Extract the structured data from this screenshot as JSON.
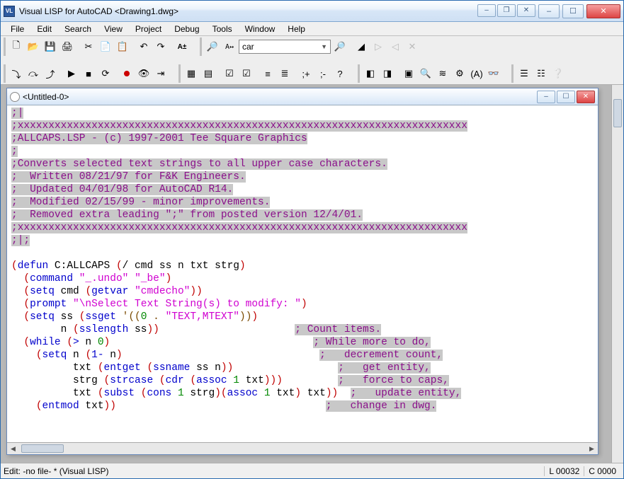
{
  "window": {
    "title": "Visual LISP for AutoCAD <Drawing1.dwg>"
  },
  "menu": {
    "file": "File",
    "edit": "Edit",
    "search": "Search",
    "view": "View",
    "project": "Project",
    "debug": "Debug",
    "tools": "Tools",
    "window": "Window",
    "help": "Help"
  },
  "toolbar": {
    "search_value": "car"
  },
  "child_window": {
    "title": "<Untitled-0>"
  },
  "code": {
    "l1": ";|",
    "l2": ";xxxxxxxxxxxxxxxxxxxxxxxxxxxxxxxxxxxxxxxxxxxxxxxxxxxxxxxxxxxxxxxxxxxxxxxxx",
    "l3": ";ALLCAPS.LSP - (c) 1997-2001 Tee Square Graphics",
    "l4": ";",
    "l5": ";Converts selected text strings to all upper case characters.",
    "l6": ";  Written 08/21/97 for F&K Engineers.",
    "l7": ";  Updated 04/01/98 for AutoCAD R14.",
    "l8": ";  Modified 02/15/99 - minor improvements.",
    "l9": ";  Removed extra leading \";\" from posted version 12/4/01.",
    "l10": ";xxxxxxxxxxxxxxxxxxxxxxxxxxxxxxxxxxxxxxxxxxxxxxxxxxxxxxxxxxxxxxxxxxxxxxxxx",
    "l11": ";|;",
    "defun": "defun",
    "fn_name": "C:ALLCAPS",
    "fn_args": "/ cmd ss n txt strg",
    "command": "command",
    "s_undo": "\"_.undo\"",
    "s_be": "\"_be\"",
    "setq": "setq",
    "getvar": "getvar",
    "s_cmdecho": "\"cmdecho\"",
    "prompt": "prompt",
    "s_prompt": "\"\\nSelect Text String(s) to modify: \"",
    "ssget": "ssget",
    "ssget_arg_open": "'((",
    "zero": "0",
    "dot": " . ",
    "s_textmtext": "\"TEXT,MTEXT\"",
    "ssget_arg_close": "))",
    "sslength": "sslength",
    "while": "while",
    "gt": ">",
    "oneminus": "1-",
    "entget": "entget",
    "ssname": "ssname",
    "strcase": "strcase",
    "cdr": "cdr",
    "assoc": "assoc",
    "one": "1",
    "subst": "subst",
    "cons": "cons",
    "entmod": "entmod",
    "c_count": "; Count items.",
    "c_while": "; While more to do,",
    "c_dec": ";   decrement count,",
    "c_get": ";   get entity,",
    "c_force": ";   force to caps,",
    "c_upd": ";   update entity,",
    "c_chg": ";   change in dwg."
  },
  "status": {
    "left": "Edit:  -no file- * (Visual LISP)",
    "line": "L 00032",
    "col": "C 0000"
  }
}
